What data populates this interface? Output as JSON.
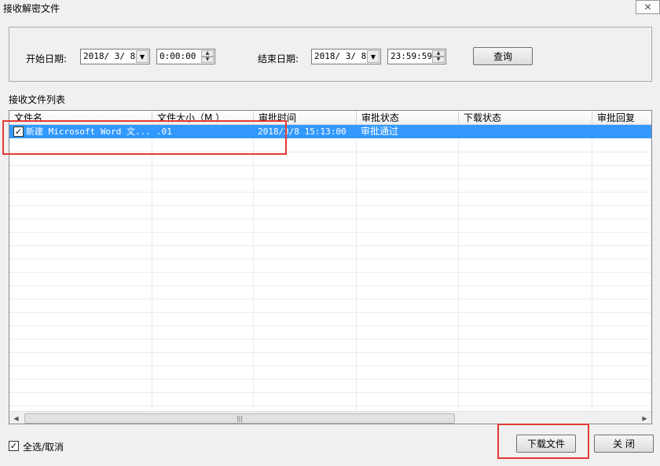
{
  "window": {
    "title": "接收解密文件"
  },
  "filter": {
    "start_label": "开始日期:",
    "start_date": "2018/ 3/ 8",
    "start_time": "0:00:00",
    "end_label": "结束日期:",
    "end_date": "2018/ 3/ 8",
    "end_time": "23:59:59",
    "query_button": "查询"
  },
  "list": {
    "section_label": "接收文件列表",
    "columns": [
      "文件名",
      "文件大小（M ）",
      "审批时间",
      "审批状态",
      "下载状态",
      "审批回复"
    ],
    "rows": [
      {
        "checked": true,
        "filename": "新建 Microsoft Word 文...",
        "size": ".01",
        "approve_time": "2018/3/8 15:13:00",
        "approve_status": "审批通过",
        "download_status": "",
        "reply": ""
      }
    ]
  },
  "footer": {
    "select_all_label": "全选/取消",
    "select_all_checked": true,
    "download_button": "下载文件",
    "close_button": "关 闭"
  },
  "colors": {
    "selection": "#3399ff",
    "highlight_box": "#e53935"
  }
}
